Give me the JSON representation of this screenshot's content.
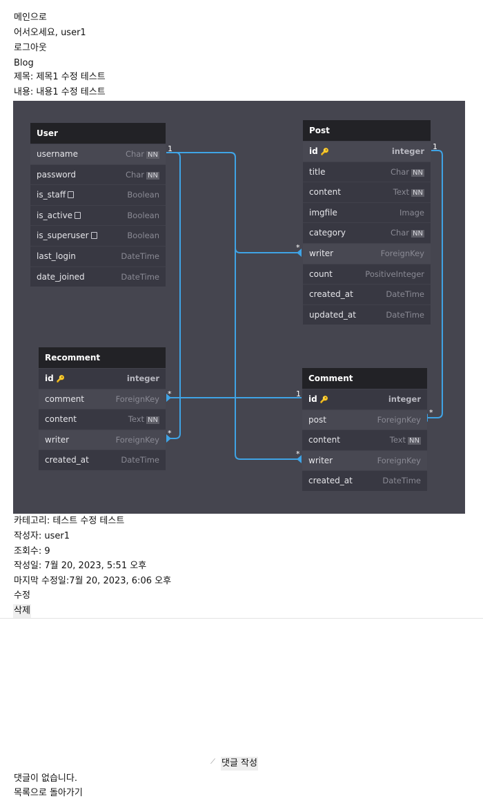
{
  "nav": {
    "main_link": "메인으로",
    "welcome": "어서오세요, user1",
    "logout": "로그아웃",
    "site_name": "Blog"
  },
  "post": {
    "title_line": "제목: 제목1 수정 테스트",
    "content_line": "내용: 내용1 수정 테스트",
    "category_line": "카테고리: 테스트 수정 테스트",
    "writer_line": "작성자: user1",
    "views_line": "조회수: 9",
    "created_line": "작성일: 7월 20, 2023, 5:51 오후",
    "updated_line": "마지막 수정일:7월 20, 2023, 6:06 오후",
    "edit_button": "수정",
    "delete_button": "삭제"
  },
  "diagram": {
    "tables": {
      "user": {
        "name": "User",
        "fields": [
          {
            "name": "username",
            "type": "Char",
            "nn": "NN"
          },
          {
            "name": "password",
            "type": "Char",
            "nn": "NN"
          },
          {
            "name": "is_staff",
            "type": "Boolean"
          },
          {
            "name": "is_active",
            "type": "Boolean"
          },
          {
            "name": "is_superuser",
            "type": "Boolean"
          },
          {
            "name": "last_login",
            "type": "DateTime"
          },
          {
            "name": "date_joined",
            "type": "DateTime"
          }
        ]
      },
      "post": {
        "name": "Post",
        "fields": [
          {
            "name": "id",
            "type": "integer"
          },
          {
            "name": "title",
            "type": "Char",
            "nn": "NN"
          },
          {
            "name": "content",
            "type": "Text",
            "nn": "NN"
          },
          {
            "name": "imgfile",
            "type": "Image"
          },
          {
            "name": "category",
            "type": "Char",
            "nn": "NN"
          },
          {
            "name": "writer",
            "type": "ForeignKey"
          },
          {
            "name": "count",
            "type": "PositiveInteger"
          },
          {
            "name": "created_at",
            "type": "DateTime"
          },
          {
            "name": "updated_at",
            "type": "DateTime"
          }
        ]
      },
      "recomment": {
        "name": "Recomment",
        "fields": [
          {
            "name": "id",
            "type": "integer"
          },
          {
            "name": "comment",
            "type": "ForeignKey"
          },
          {
            "name": "content",
            "type": "Text",
            "nn": "NN"
          },
          {
            "name": "writer",
            "type": "ForeignKey"
          },
          {
            "name": "created_at",
            "type": "DateTime"
          }
        ]
      },
      "comment": {
        "name": "Comment",
        "fields": [
          {
            "name": "id",
            "type": "integer"
          },
          {
            "name": "post",
            "type": "ForeignKey"
          },
          {
            "name": "content",
            "type": "Text",
            "nn": "NN"
          },
          {
            "name": "writer",
            "type": "ForeignKey"
          },
          {
            "name": "created_at",
            "type": "DateTime"
          }
        ]
      }
    },
    "cardinality": {
      "one": "1",
      "many": "*"
    },
    "colors": {
      "relation_line": "#3fa4e6",
      "background": "#45454f",
      "table_body": "#383842",
      "table_header": "#222226"
    }
  },
  "comments": {
    "submit_button": "댓글 작성",
    "empty_text": "댓글이 없습니다.",
    "back_link": "목록으로 돌아가기",
    "resize_icon": "resize-grip-icon"
  }
}
